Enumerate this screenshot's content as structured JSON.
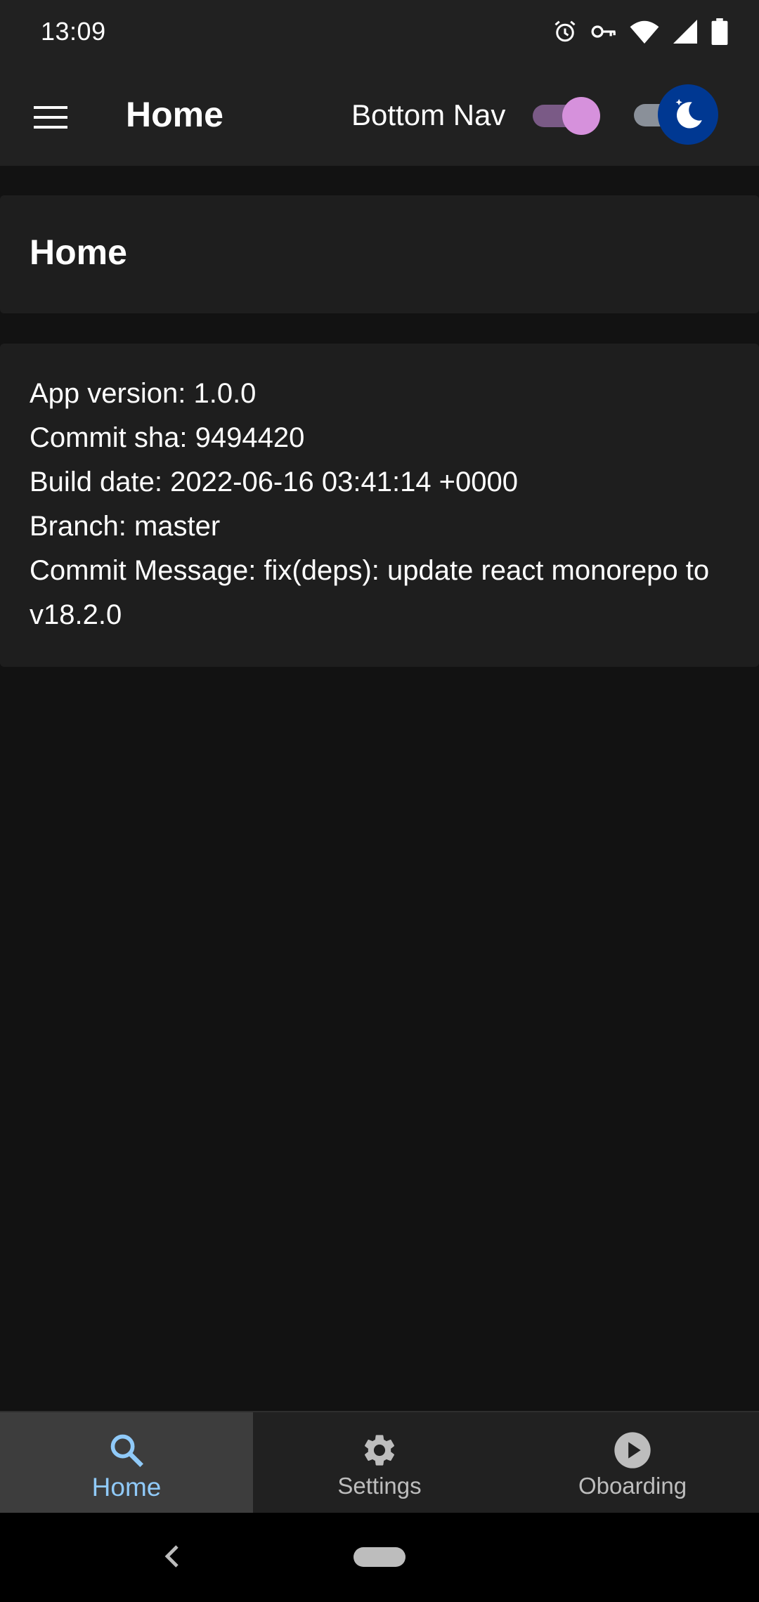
{
  "status_bar": {
    "time": "13:09",
    "icons": [
      "alarm-icon",
      "vpn-key-icon",
      "wifi-icon",
      "signal-icon",
      "battery-icon"
    ]
  },
  "app_bar": {
    "title": "Home",
    "bottom_nav_label": "Bottom Nav",
    "bottom_nav_switch_on": true,
    "dark_theme_switch_on": true
  },
  "title_card": {
    "heading": "Home"
  },
  "info_card": {
    "lines": [
      "App version: 1.0.0",
      "Commit sha: 9494420",
      "Build date: 2022-06-16 03:41:14 +0000",
      "Branch: master",
      "Commit Message: fix(deps): update react monorepo to v18.2.0"
    ]
  },
  "bottom_nav": {
    "items": [
      {
        "label": "Home",
        "icon": "search-icon",
        "active": true
      },
      {
        "label": "Settings",
        "icon": "gear-icon",
        "active": false
      },
      {
        "label": "Oboarding",
        "icon": "play-circle-icon",
        "active": false
      }
    ]
  },
  "colors": {
    "background": "#121212",
    "surface": "#1e1e1e",
    "app_bar": "#212121",
    "active_nav_label": "#90caf9",
    "switch_thumb": "#d691dc",
    "theme_thumb": "#003892"
  }
}
